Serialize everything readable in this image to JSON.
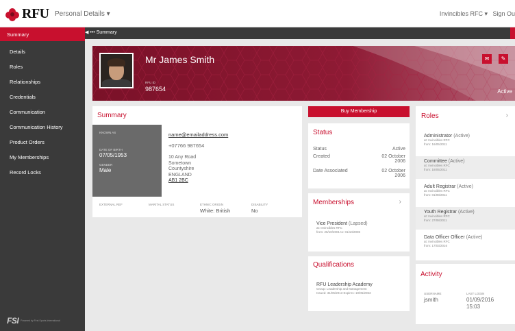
{
  "header": {
    "logo": "RFU",
    "menu": "Personal Details",
    "club": "Invincibles RFC",
    "signout": "Sign Ou"
  },
  "sidebar": {
    "active": "Summary",
    "items": [
      "Details",
      "Roles",
      "Relationships",
      "Credentials",
      "Communication",
      "Communication History",
      "Product Orders",
      "My Memberships",
      "Record Locks"
    ],
    "fsi_logo": "FSI",
    "fsi_sub": "Powered by\nFirst Sports International"
  },
  "breadcrumb": "Summary",
  "profile": {
    "name": "Mr James Smith",
    "rfu_id_label": "RFU ID",
    "rfu_id": "987654",
    "status": "Active"
  },
  "summary": {
    "title": "Summary",
    "known_as_label": "KNOWN AS",
    "dob_label": "DATE OF BIRTH",
    "dob": "07/05/1953",
    "gender_label": "GENDER",
    "gender": "Male",
    "email": "name@emailaddress.com",
    "phone": "+07766 987654",
    "address": [
      "10 Any Road",
      "Sometown",
      "Countyshire",
      "ENGLAND"
    ],
    "postcode": "AB1 2BC",
    "external_ref_label": "EXTERNAL REF",
    "marital_label": "MARITAL STATUS",
    "ethnic_label": "ETHNIC ORIGIN",
    "ethnic": "White: British",
    "disability_label": "DISABILITY",
    "disability": "No"
  },
  "buy_button": "Buy Membership",
  "status": {
    "title": "Status",
    "status_label": "Status",
    "status_value": "Active",
    "created_label": "Created",
    "created_value": "02 October",
    "created_year": "2006",
    "assoc_label": "Date Associated",
    "assoc_value": "02 October",
    "assoc_year": "2006"
  },
  "memberships": {
    "title": "Memberships",
    "item_name": "Vice President",
    "item_state": "(Lapsed)",
    "item_at": "at: Invincibles RFC",
    "item_dates": "from: 25/10/2001  to: 01/10/2006"
  },
  "qualifications": {
    "title": "Qualifications",
    "name": "RFU Leadership Academy",
    "group": "Group: Leadership and Management",
    "issued": "Issued: 31/05/2013  Expires: 19/05/2063"
  },
  "roles": {
    "title": "Roles",
    "items": [
      {
        "name": "Administrator",
        "state": "(Active)",
        "at": "at: Invincibles RFC",
        "from": "from: 16/05/2011"
      },
      {
        "name": "Committee",
        "state": "(Active)",
        "at": "at: Invincibles RFC",
        "from": "from: 18/05/2011"
      },
      {
        "name": "Adult Registrar",
        "state": "(Active)",
        "at": "at: Invincibles RFC",
        "from": "from: 01/08/2011"
      },
      {
        "name": "Youth Registrar",
        "state": "(Active)",
        "at": "at: Invincibles RFC",
        "from": "from: 27/08/2011"
      },
      {
        "name": "Data Officer Officer",
        "state": "(Active)",
        "at": "at: Invincibles RFC",
        "from": "from: 17/03/2016"
      }
    ]
  },
  "activity": {
    "title": "Activity",
    "username_label": "USERNAME",
    "username": "jsmith",
    "last_login_label": "LAST LOGIN",
    "last_login_date": "01/09/2016",
    "last_login_time": "15:03"
  },
  "colors": {
    "accent": "#c8102e",
    "sidebar": "#3a3a3a",
    "hero": "#8a1530"
  }
}
